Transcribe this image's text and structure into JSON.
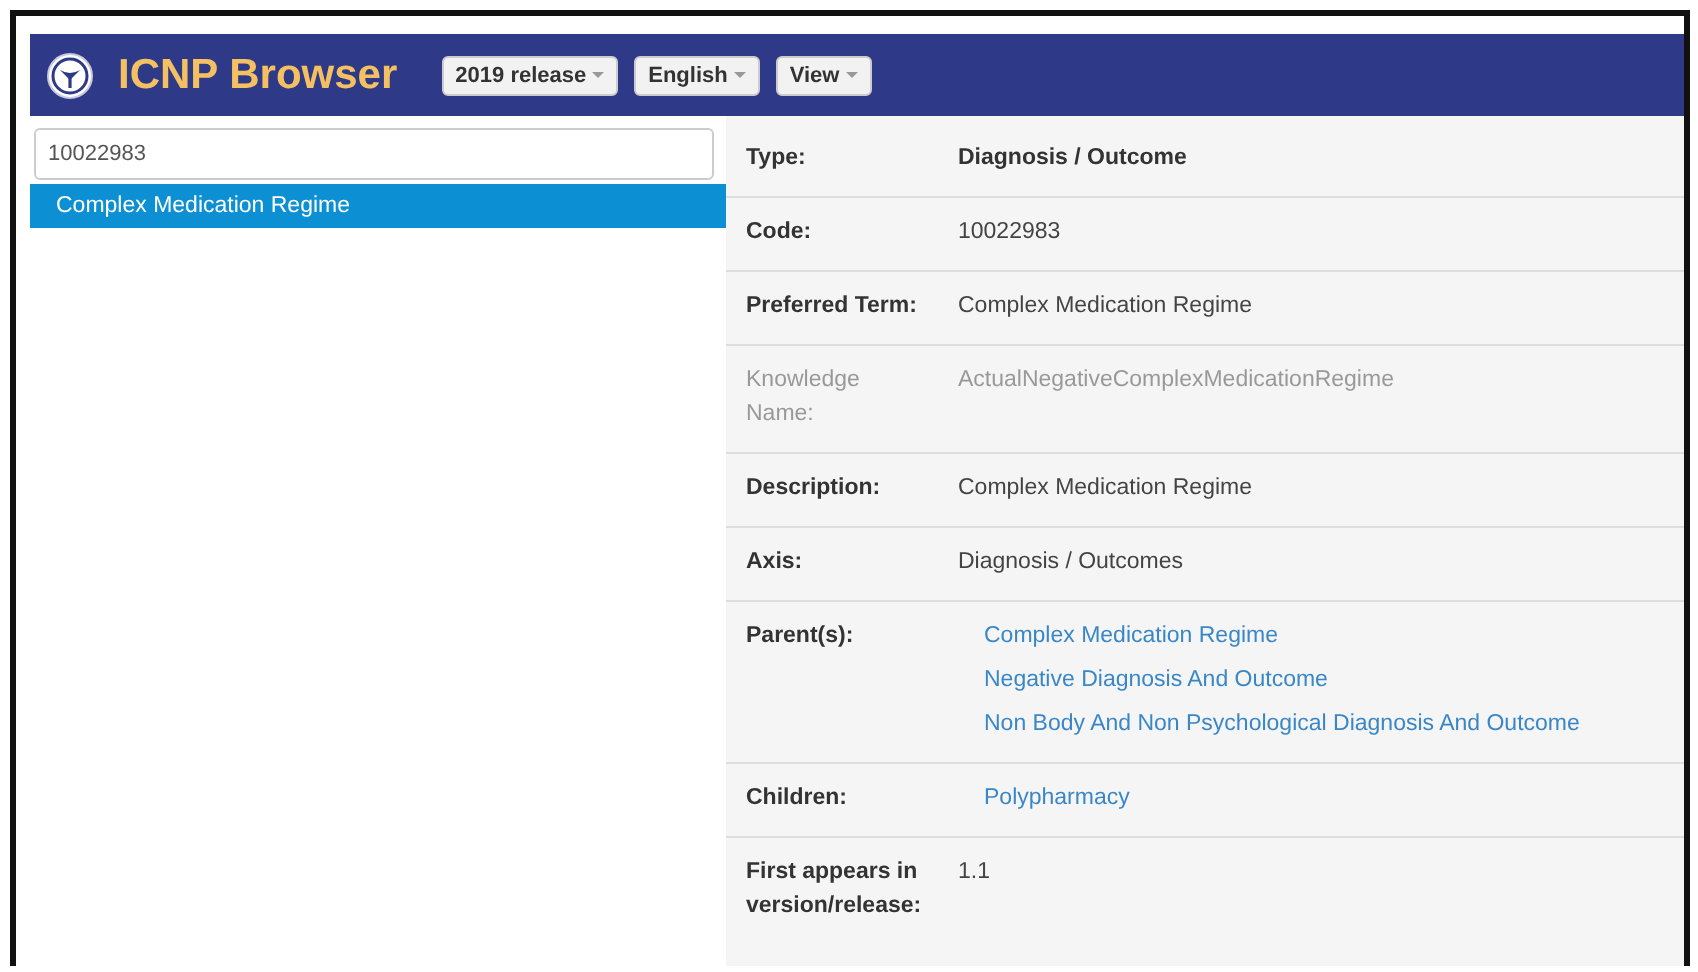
{
  "navbar": {
    "brand": "ICNP Browser",
    "menus": [
      {
        "label": "2019 release"
      },
      {
        "label": "English"
      },
      {
        "label": "View"
      }
    ]
  },
  "search": {
    "value": "10022983"
  },
  "results": [
    {
      "label": "Complex Medication Regime",
      "selected": true
    }
  ],
  "details": [
    {
      "label": "Type:",
      "kind": "bold",
      "value": "Diagnosis / Outcome"
    },
    {
      "label": "Code:",
      "kind": "text",
      "value": "10022983"
    },
    {
      "label": "Preferred Term:",
      "kind": "text",
      "value": "Complex Medication Regime"
    },
    {
      "label": "Knowledge Name:",
      "kind": "muted",
      "value": "ActualNegativeComplexMedicationRegime"
    },
    {
      "label": "Description:",
      "kind": "text",
      "value": "Complex Medication Regime"
    },
    {
      "label": "Axis:",
      "kind": "text",
      "value": "Diagnosis / Outcomes"
    },
    {
      "label": "Parent(s):",
      "kind": "links",
      "links": [
        "Complex Medication Regime",
        "Negative Diagnosis And Outcome",
        "Non Body And Non Psychological Diagnosis And Outcome"
      ]
    },
    {
      "label": "Children:",
      "kind": "links",
      "links": [
        "Polypharmacy"
      ]
    },
    {
      "label": "First appears in version/release:",
      "kind": "text",
      "value": "1.1"
    }
  ]
}
